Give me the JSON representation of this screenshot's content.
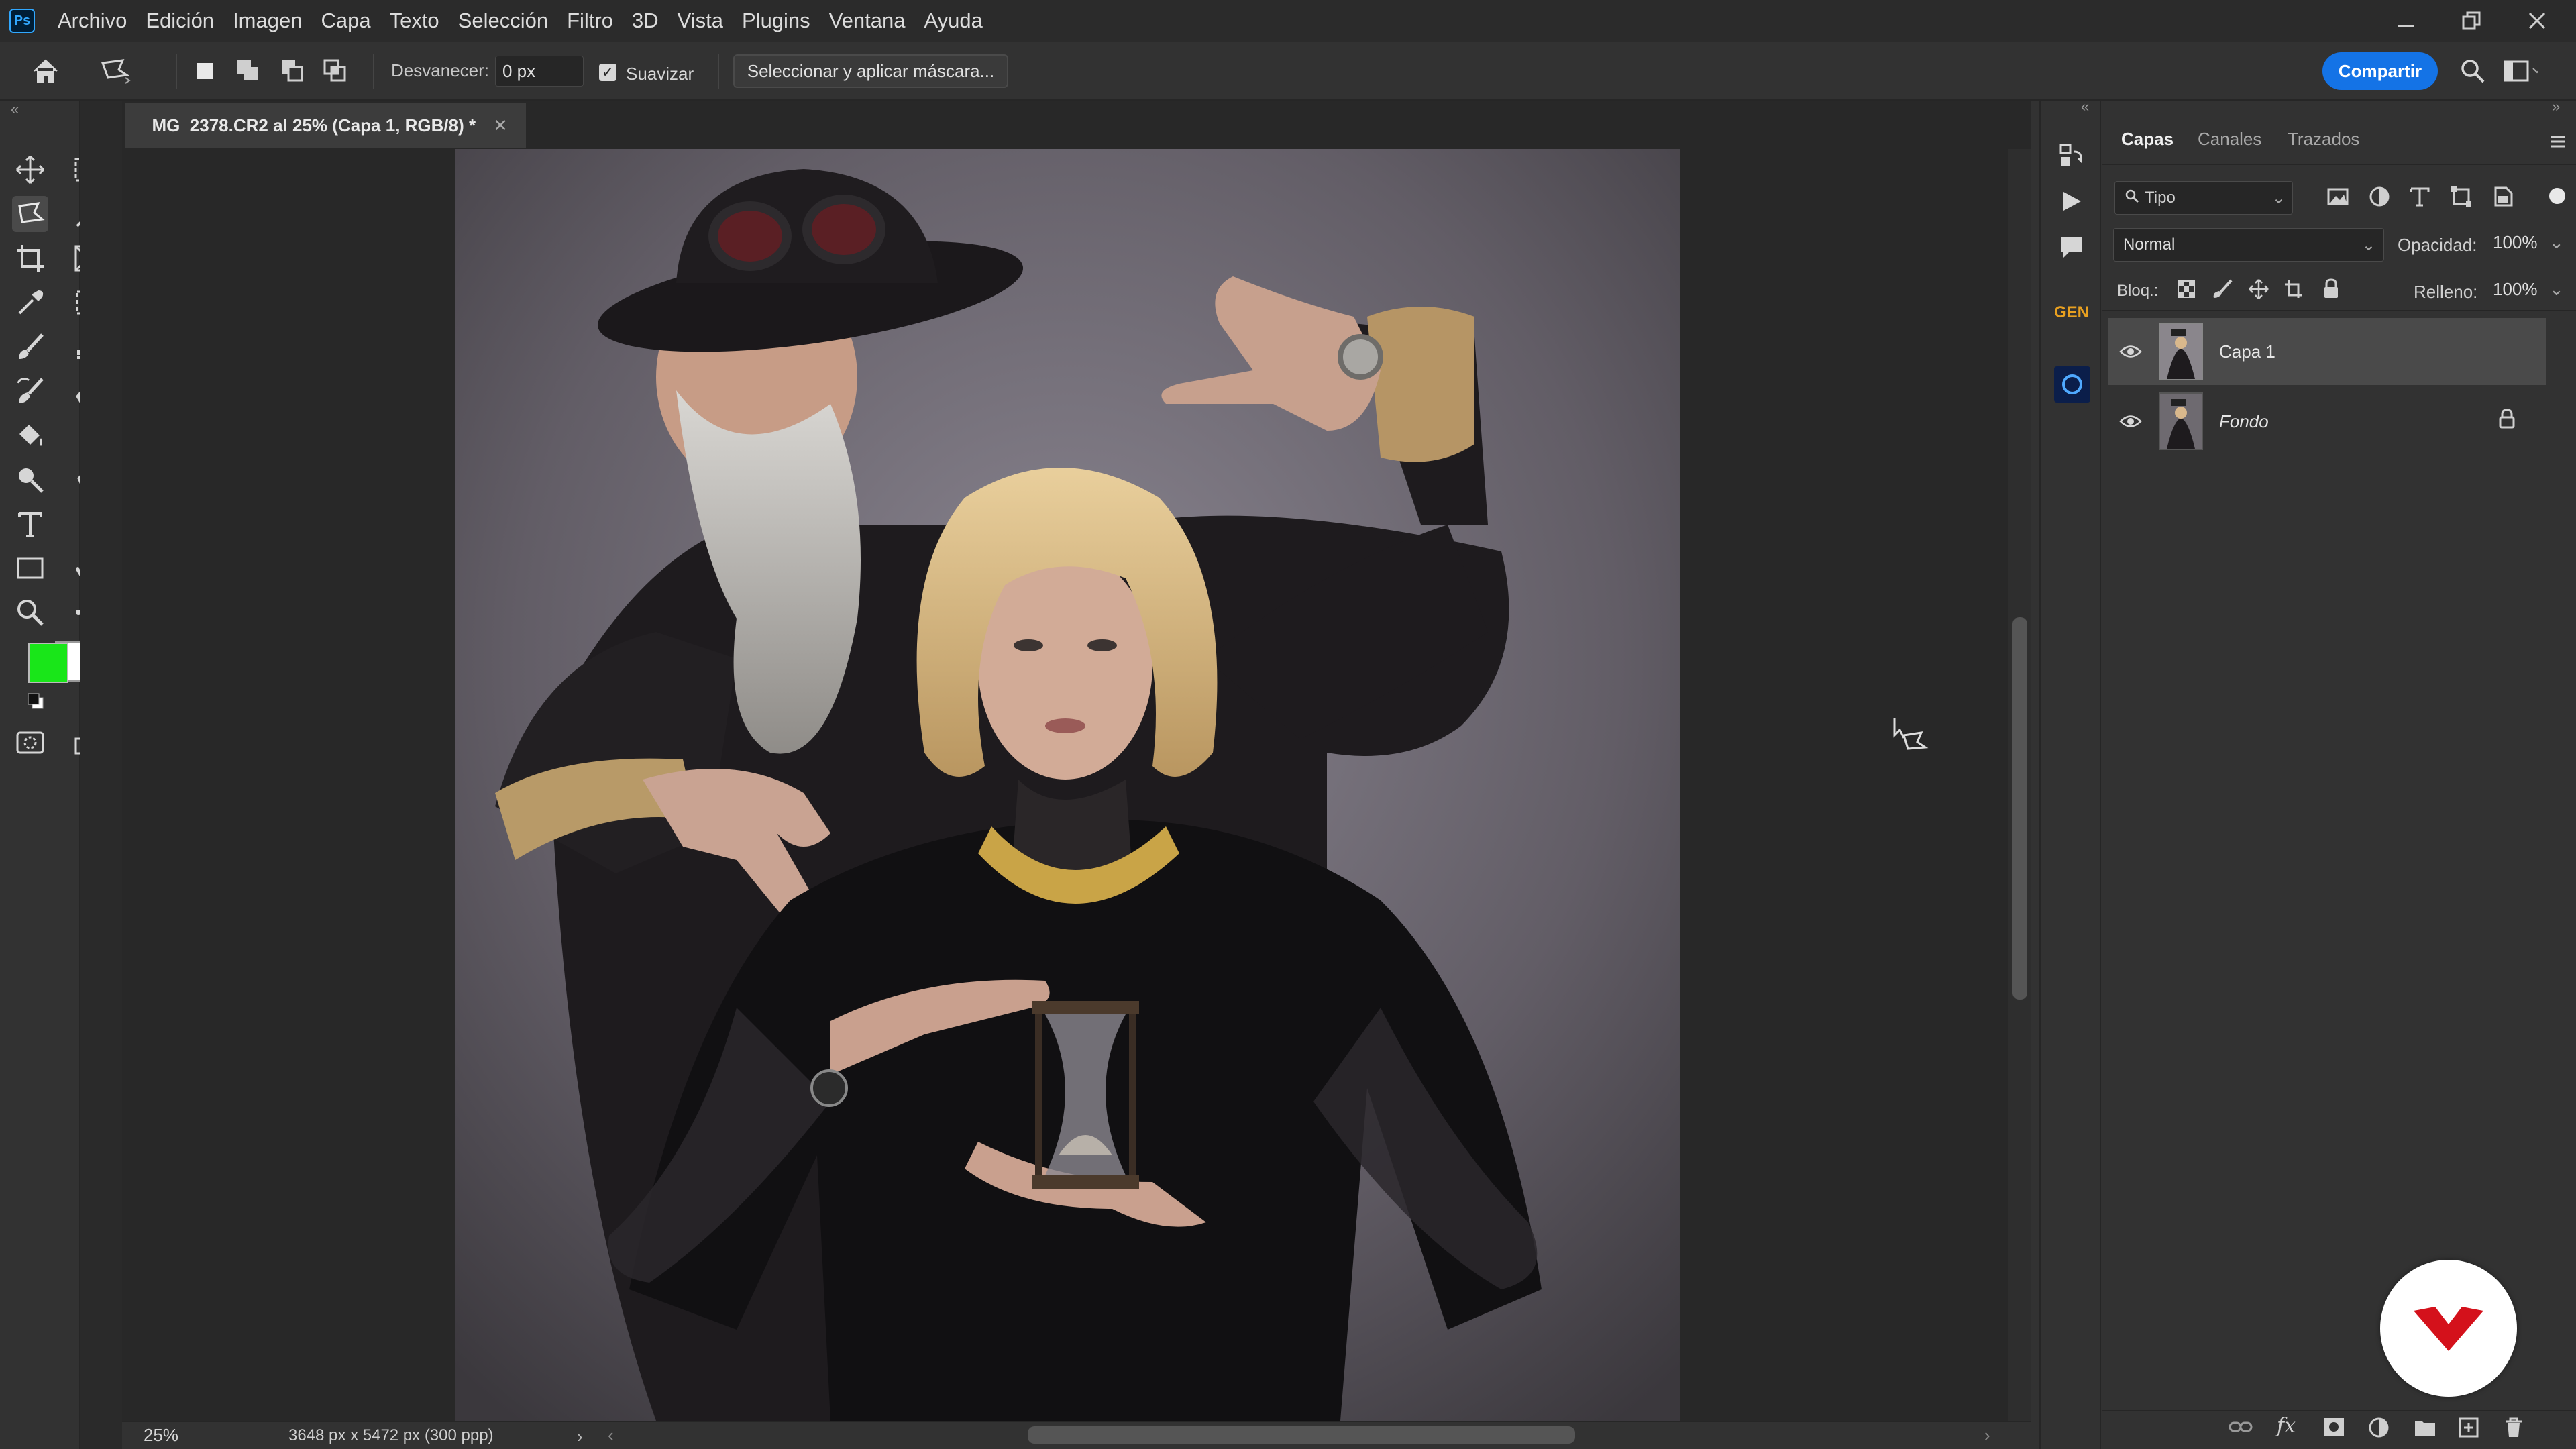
{
  "app": {
    "logo_text": "Ps",
    "menu": [
      "Archivo",
      "Edición",
      "Imagen",
      "Capa",
      "Texto",
      "Selección",
      "Filtro",
      "3D",
      "Vista",
      "Plugins",
      "Ventana",
      "Ayuda"
    ]
  },
  "options": {
    "feather_label": "Desvanecer:",
    "feather_value": "0 px",
    "antialias_label": "Suavizar",
    "antialias_checked": true,
    "select_mask_label": "Seleccionar y aplicar máscara...",
    "share_label": "Compartir"
  },
  "document": {
    "tab_title": "_MG_2378.CR2 al 25% (Capa 1, RGB/8) *",
    "zoom": "25%",
    "dimensions": "3648 px x 5472 px (300 ppp)"
  },
  "colors": {
    "foreground": "#19e619",
    "background": "#ffffff",
    "accent": "#1473e6",
    "brand": "#d4111b"
  },
  "layers_panel": {
    "tabs": [
      "Capas",
      "Canales",
      "Trazados"
    ],
    "filter_label": "Tipo",
    "blend_mode": "Normal",
    "opacity_label": "Opacidad:",
    "opacity_value": "100%",
    "lock_label": "Bloq.:",
    "fill_label": "Relleno:",
    "fill_value": "100%",
    "layers": [
      {
        "name": "Capa 1",
        "visible": true,
        "selected": true,
        "locked": false
      },
      {
        "name": "Fondo",
        "visible": true,
        "selected": false,
        "locked": true
      }
    ]
  },
  "icon_column": {
    "gen_label": "GEN"
  }
}
